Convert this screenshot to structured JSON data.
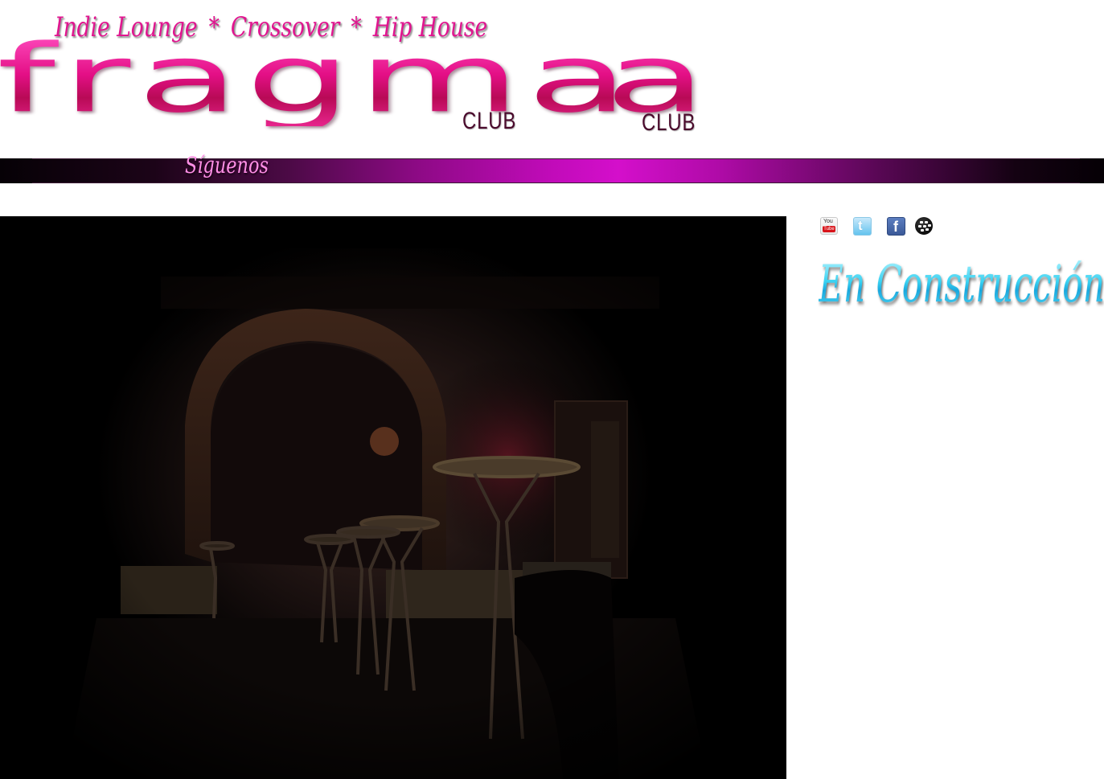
{
  "header": {
    "tagline": [
      "Indie Lounge",
      "Crossover",
      "Hip House"
    ],
    "tagline_separator": "*",
    "logo_word": "fragma",
    "logo_second_letter": "a",
    "club_label_1": "CLUB",
    "club_label_2": "CLUB",
    "brand_color": "#e3137f"
  },
  "nav": {
    "follow_label": "Síguenos",
    "bar_accent_color": "#d40fcb"
  },
  "social": [
    {
      "name": "youtube",
      "icon": "youtube-icon",
      "label_top": "You",
      "label_bottom": "Tube"
    },
    {
      "name": "twitter",
      "icon": "twitter-icon",
      "glyph": "t"
    },
    {
      "name": "facebook",
      "icon": "facebook-icon",
      "glyph": "f"
    },
    {
      "name": "blackberry-messenger",
      "icon": "bbm-icon"
    }
  ],
  "sidebar": {
    "status_text": "En Construcción",
    "status_color": "#39d2f2"
  },
  "main": {
    "photo_subject": "dim club interior with bar stools under a brick arch"
  }
}
